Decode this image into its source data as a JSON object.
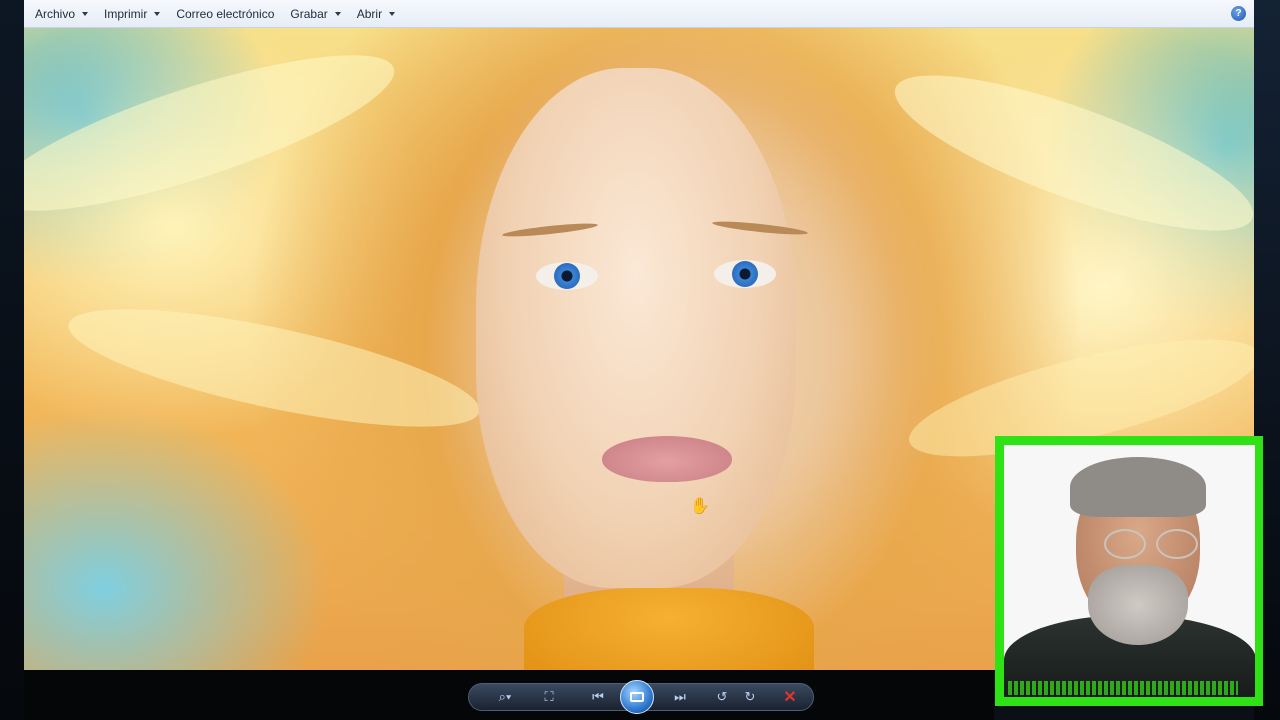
{
  "menubar": {
    "items": [
      {
        "label": "Archivo",
        "has_caret": true
      },
      {
        "label": "Imprimir",
        "has_caret": true
      },
      {
        "label": "Correo electrónico",
        "has_caret": false
      },
      {
        "label": "Grabar",
        "has_caret": true
      },
      {
        "label": "Abrir",
        "has_caret": true
      }
    ],
    "help_symbol": "?"
  },
  "viewer": {
    "image_subject": "portrait-photo",
    "cursor_icon": "hand-grab-icon"
  },
  "toolbar": {
    "buttons": [
      {
        "name": "zoom-icon",
        "glyph": "⌕▾"
      },
      {
        "name": "actual-size-icon",
        "glyph": "⛶"
      },
      {
        "name": "previous-icon",
        "glyph": "⏮"
      },
      {
        "name": "slideshow-icon",
        "glyph": ""
      },
      {
        "name": "next-icon",
        "glyph": "⏭"
      },
      {
        "name": "rotate-left-icon",
        "glyph": "↺"
      },
      {
        "name": "rotate-right-icon",
        "glyph": "↻"
      },
      {
        "name": "delete-icon",
        "glyph": "✕"
      }
    ]
  },
  "webcam_overlay": {
    "border_color": "#2fe216"
  }
}
